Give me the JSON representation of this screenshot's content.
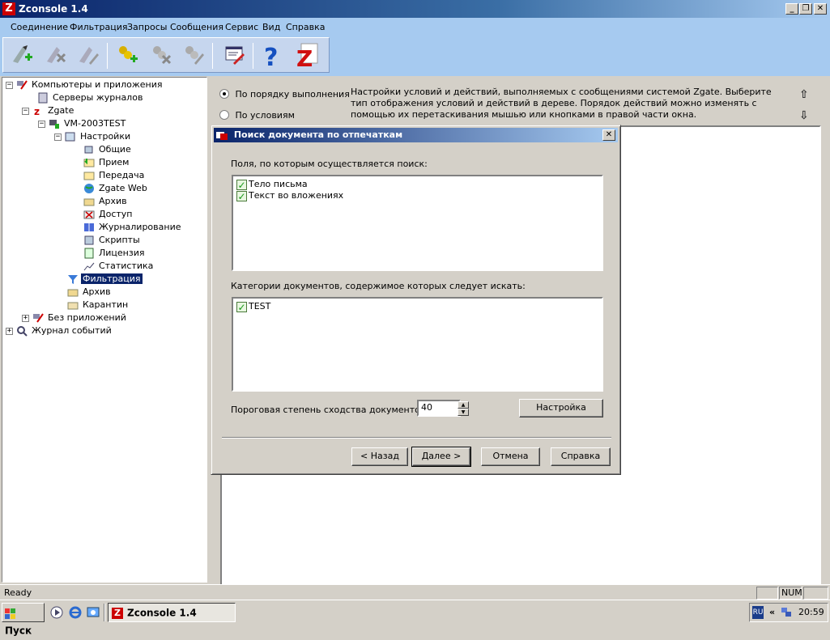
{
  "window": {
    "title": "Zconsole 1.4",
    "app_icon_letter": "Z",
    "controls": {
      "minimize": "_",
      "restore": "❐",
      "close": "✕"
    }
  },
  "menubar": {
    "items": [
      "Соединение",
      "Фильтрация",
      "Запросы",
      "Сообщения",
      "Сервис",
      "Вид",
      "Справка"
    ]
  },
  "toolbar": {
    "buttons": [
      {
        "icon": "add-connection-icon"
      },
      {
        "icon": "remove-connection-icon"
      },
      {
        "icon": "edit-connection-icon"
      },
      {
        "icon": "add-item-icon"
      },
      {
        "icon": "remove-item-icon"
      },
      {
        "icon": "edit-item-icon"
      },
      {
        "icon": "properties-icon"
      },
      {
        "icon": "help-icon"
      },
      {
        "icon": "zgate-logo-icon"
      }
    ]
  },
  "tree": {
    "items": [
      {
        "label": "Компьютеры и приложения",
        "icon": "computers-icon",
        "expander": "−"
      },
      {
        "label": "Серверы журналов",
        "icon": "log-servers-icon"
      },
      {
        "label": "Zgate",
        "icon": "zgate-icon",
        "expander": "−"
      },
      {
        "label": "VM-2003TEST",
        "icon": "server-icon",
        "expander": "−"
      },
      {
        "label": "Настройки",
        "icon": "settings-icon",
        "expander": "−"
      },
      {
        "label": "Общие",
        "icon": "general-icon"
      },
      {
        "label": "Прием",
        "icon": "receive-icon"
      },
      {
        "label": "Передача",
        "icon": "send-icon"
      },
      {
        "label": "Zgate Web",
        "icon": "web-icon"
      },
      {
        "label": "Архив",
        "icon": "archive-icon"
      },
      {
        "label": "Доступ",
        "icon": "access-icon"
      },
      {
        "label": "Журналирование",
        "icon": "logging-icon"
      },
      {
        "label": "Скрипты",
        "icon": "scripts-icon"
      },
      {
        "label": "Лицензия",
        "icon": "license-icon"
      },
      {
        "label": "Статистика",
        "icon": "statistics-icon"
      },
      {
        "label": "Фильтрация",
        "icon": "filter-icon"
      },
      {
        "label": "Архив",
        "icon": "archive-icon"
      },
      {
        "label": "Карантин",
        "icon": "quarantine-icon"
      },
      {
        "label": "Без приложений",
        "icon": "no-apps-icon",
        "expander": "+"
      },
      {
        "label": "Журнал событий",
        "icon": "event-log-icon",
        "expander": "+"
      }
    ],
    "selected_label": "Фильтрация"
  },
  "right": {
    "radio_order": "По порядку выполнения",
    "radio_conditions": "По условиям",
    "radio_selected": "order",
    "description": "Настройки условий и действий, выполняемых с сообщениями системой Zgate. Выберите тип отображения условий и действий в дереве. Порядок действий можно изменять с помощью их перетаскивания мышью или кнопками в правой части окна.",
    "arrow_up": "⇧",
    "arrow_down": "⇩"
  },
  "dialog": {
    "title": "Поиск документа по отпечаткам",
    "close": "✕",
    "fields_label": "Поля, по которым осуществляется поиск:",
    "fields": [
      {
        "label": "Тело письма",
        "checked": true
      },
      {
        "label": "Текст во вложениях",
        "checked": true
      }
    ],
    "categories_label": "Категории документов, содержимое которых следует искать:",
    "categories": [
      {
        "label": "TEST",
        "checked": true
      }
    ],
    "threshold_label": "Пороговая степень сходства документов:",
    "threshold_value": "40",
    "settings_button": "Настройка",
    "back_button": "< Назад",
    "next_button": "Далее >",
    "cancel_button": "Отмена",
    "help_button": "Справка"
  },
  "statusbar": {
    "text": "Ready",
    "num": "NUM"
  },
  "taskbar": {
    "start": "Пуск",
    "task": "Zconsole 1.4",
    "lang": "RU",
    "chevron": "«",
    "time": "20:59"
  }
}
